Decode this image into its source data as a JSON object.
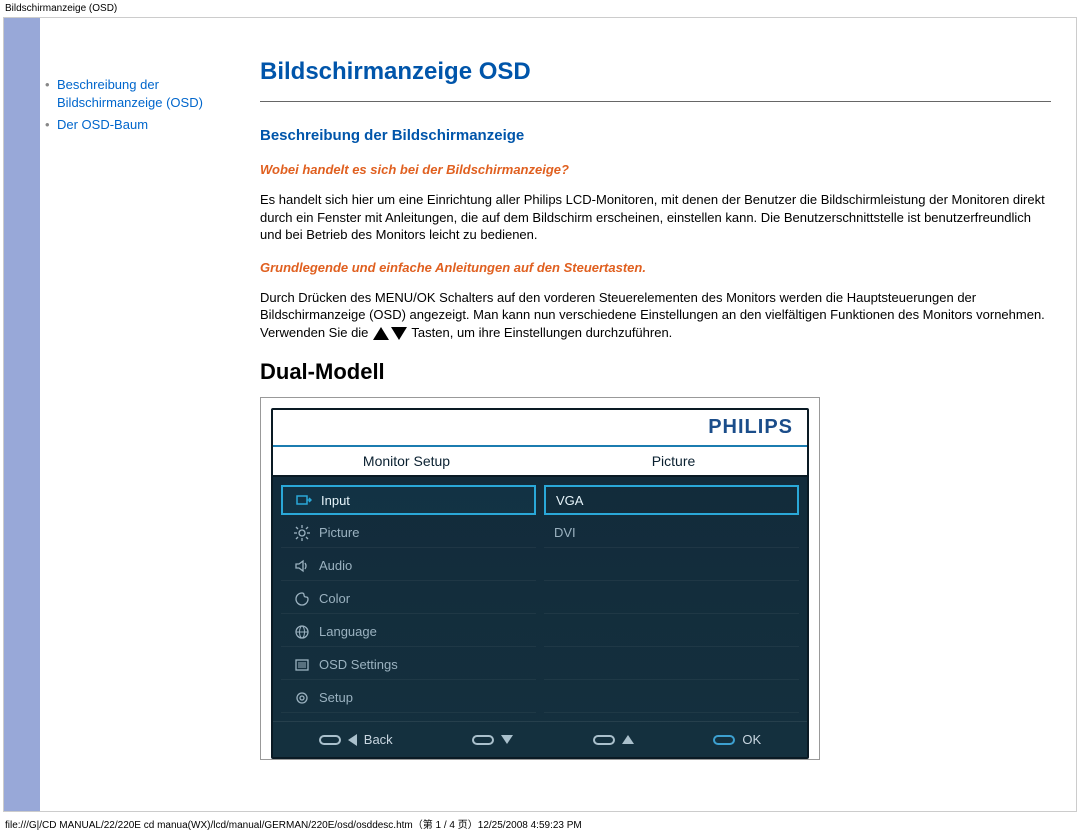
{
  "meta": {
    "top_title": "Bildschirmanzeige (OSD)",
    "file_path": "file:///G|/CD MANUAL/22/220E cd manua(WX)/lcd/manual/GERMAN/220E/osd/osddesc.htm（第 1 / 4 页）12/25/2008 4:59:23 PM"
  },
  "sidebar": {
    "items": [
      {
        "label": "Beschreibung der Bildschirmanzeige (OSD)"
      },
      {
        "label": "Der OSD-Baum"
      }
    ]
  },
  "content": {
    "title": "Bildschirmanzeige OSD",
    "section1_heading": "Beschreibung der Bildschirmanzeige",
    "q1": "Wobei handelt es sich bei der Bildschirmanzeige?",
    "p1": "Es handelt sich hier um eine Einrichtung aller Philips LCD-Monitoren, mit denen der Benutzer die Bildschirmleistung der Monitoren direkt durch ein Fenster mit Anleitungen, die auf dem Bildschirm erscheinen, einstellen kann. Die Benutzerschnittstelle ist benutzerfreundlich und bei Betrieb des Monitors leicht zu bedienen.",
    "q2": "Grundlegende und einfache Anleitungen auf den Steuertasten.",
    "p2a": "Durch Drücken des MENU/OK Schalters auf den vorderen Steuerelementen des Monitors werden die Hauptsteuerungen der Bildschirmanzeige (OSD) angezeigt. Man kann nun verschiedene Einstellungen an den vielfältigen Funktionen des Monitors vornehmen. Verwenden Sie die ",
    "p2b": " Tasten, um ihre Einstellungen durchzuführen.",
    "dual_model": "Dual-Modell"
  },
  "osd": {
    "brand": "PHILIPS",
    "col_left_header": "Monitor Setup",
    "col_right_header": "Picture",
    "left_menu": [
      {
        "label": "Input",
        "icon": "input-icon",
        "selected": true
      },
      {
        "label": "Picture",
        "icon": "sun-icon",
        "selected": false
      },
      {
        "label": "Audio",
        "icon": "speaker-icon",
        "selected": false
      },
      {
        "label": "Color",
        "icon": "palette-icon",
        "selected": false
      },
      {
        "label": "Language",
        "icon": "globe-icon",
        "selected": false
      },
      {
        "label": "OSD Settings",
        "icon": "list-icon",
        "selected": false
      },
      {
        "label": "Setup",
        "icon": "gear-icon",
        "selected": false
      }
    ],
    "right_menu": [
      {
        "label": "VGA",
        "selected": true
      },
      {
        "label": "DVI",
        "selected": false
      },
      {
        "label": "",
        "selected": false
      },
      {
        "label": "",
        "selected": false
      },
      {
        "label": "",
        "selected": false
      },
      {
        "label": "",
        "selected": false
      },
      {
        "label": "",
        "selected": false
      }
    ],
    "footer": {
      "back": "Back",
      "ok": "OK"
    }
  }
}
